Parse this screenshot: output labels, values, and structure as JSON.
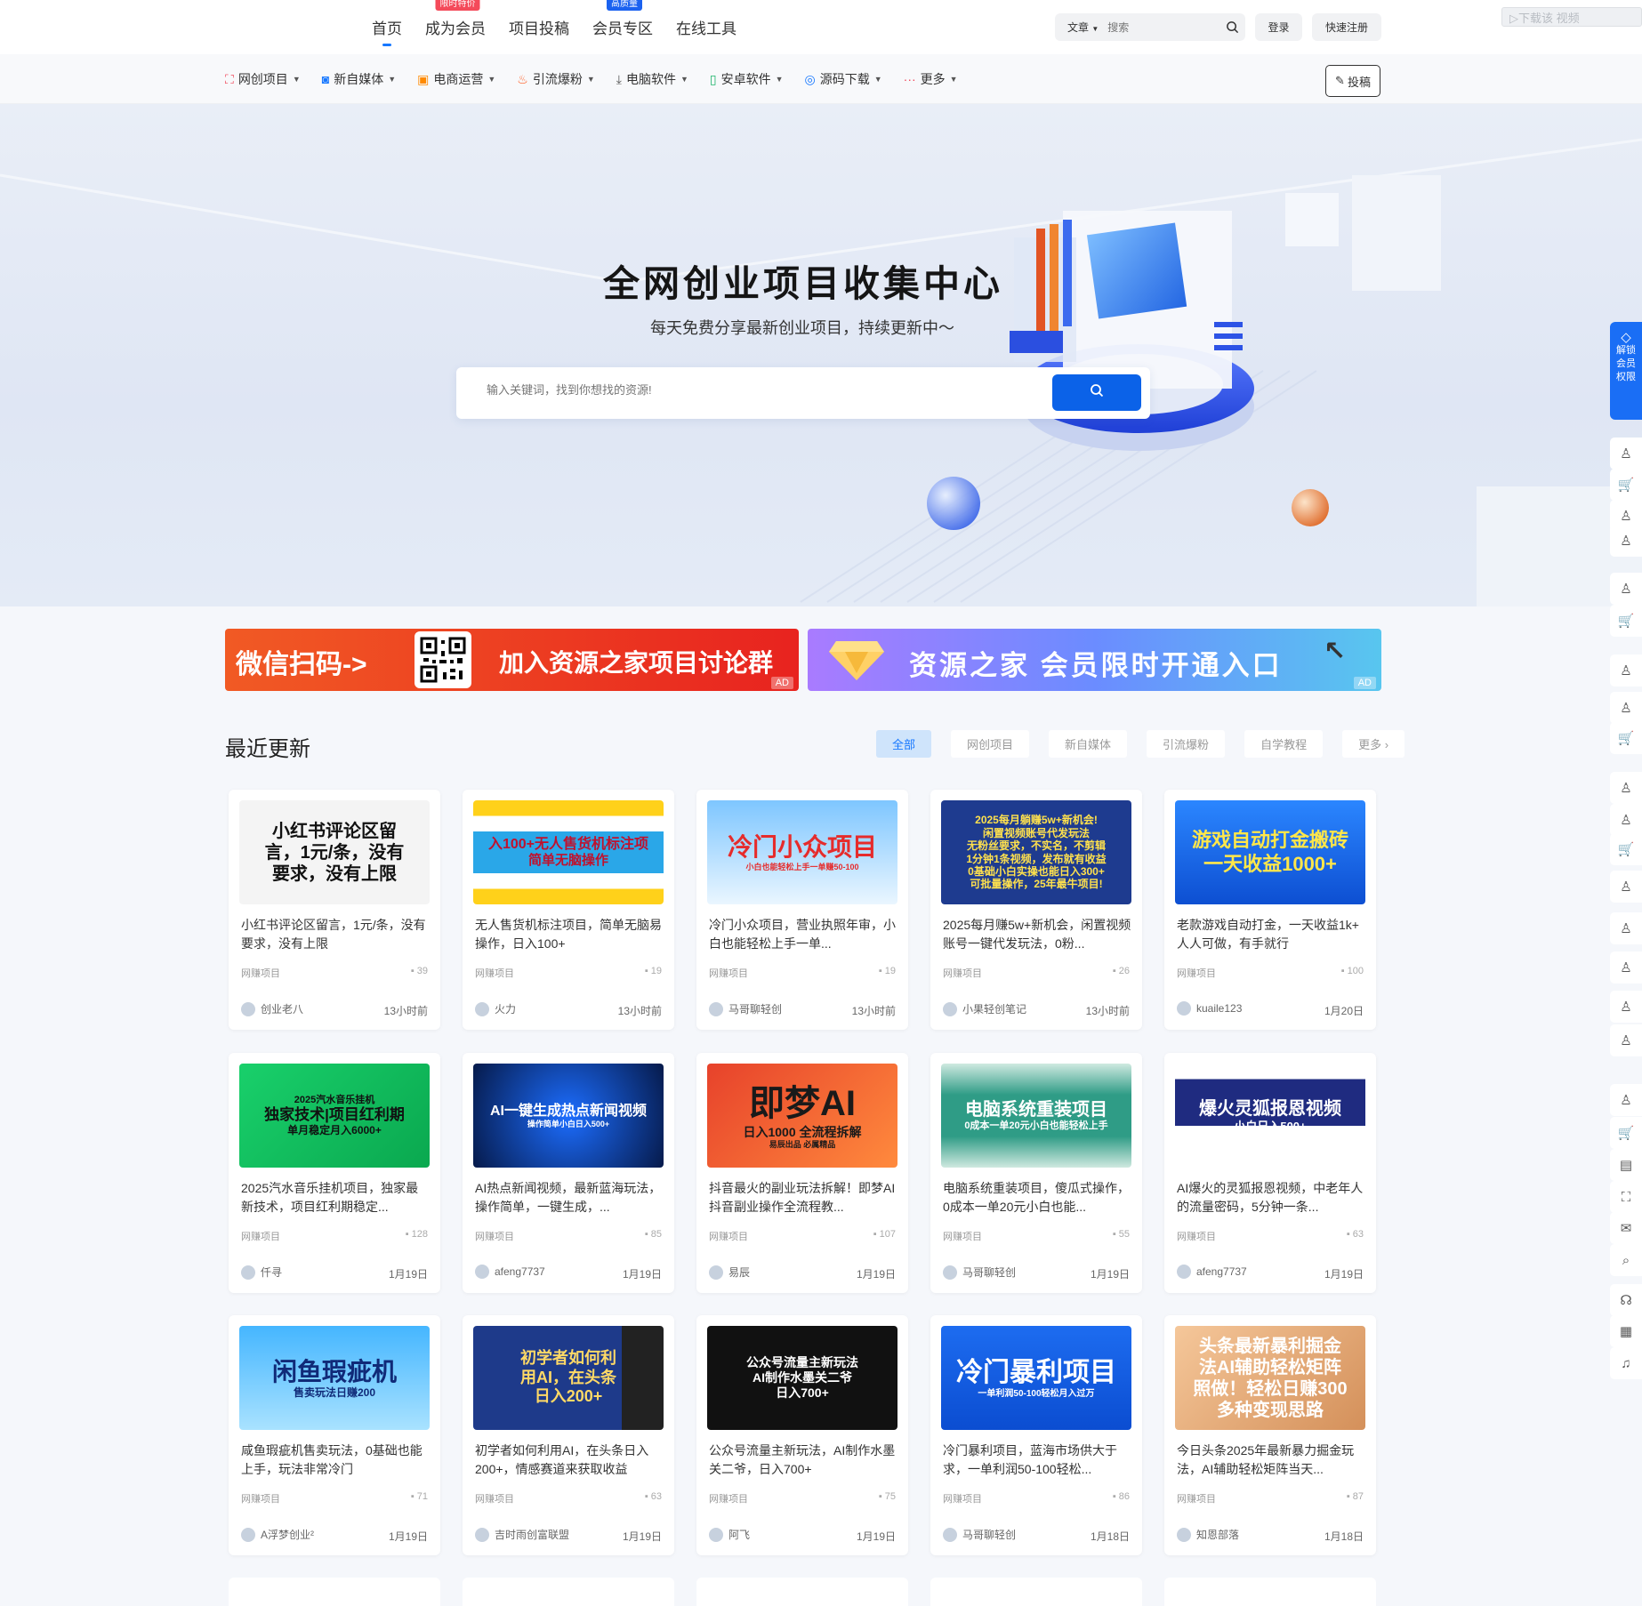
{
  "top_nav": {
    "items": [
      {
        "label": "首页",
        "badge": ""
      },
      {
        "label": "成为会员",
        "badge": "限时特价"
      },
      {
        "label": "项目投稿",
        "badge": ""
      },
      {
        "label": "会员专区",
        "badge": "高质量"
      },
      {
        "label": "在线工具",
        "badge": ""
      }
    ],
    "search_type": "文章",
    "search_placeholder": "搜索",
    "login": "登录",
    "register": "快速注册",
    "corner_ad": "▷下载该 视频"
  },
  "cat_nav": {
    "items": [
      "网创项目",
      "新自媒体",
      "电商运营",
      "引流爆粉",
      "电脑软件",
      "安卓软件",
      "源码下载",
      "更多"
    ],
    "post": "投稿"
  },
  "hero": {
    "title": "全网创业项目收集中心",
    "subtitle": "每天免费分享最新创业项目，持续更新中～",
    "search_placeholder": "输入关键词，找到你想找的资源!"
  },
  "banners": [
    {
      "left_text": "微信扫码->",
      "right_text": "加入资源之家项目讨论群",
      "ad": "AD"
    },
    {
      "text": "资源之家 会员限时开通入口",
      "ad": "AD"
    }
  ],
  "section": {
    "title": "最近更新",
    "tabs": [
      "全部",
      "网创项目",
      "新自媒体",
      "引流爆粉",
      "自学教程",
      "更多 ›"
    ]
  },
  "cards": [
    {
      "thumb_lines": [
        "小红书评论区留",
        "言，1元/条，没有",
        "要求，没有上限"
      ],
      "title": "小红书评论区留言，1元/条，没有要求，没有上限",
      "tag": "网赚项目",
      "comments": "39",
      "author": "创业老八",
      "time": "13小时前"
    },
    {
      "thumb_lines": [
        "入100+无人售货机标注项",
        "简单无脑操作"
      ],
      "title": "无人售货机标注项目，简单无脑易操作，日入100+",
      "tag": "网赚项目",
      "comments": "19",
      "author": "火力",
      "time": "13小时前"
    },
    {
      "thumb_lines": [
        "冷门小众项目",
        "小白也能轻松上手一单赚50-100"
      ],
      "title": "冷门小众项目，营业执照年审，小白也能轻松上手一单...",
      "tag": "网赚项目",
      "comments": "19",
      "author": "马哥聊轻创",
      "time": "13小时前"
    },
    {
      "thumb_lines": [
        "2025每月躺赚5w+新机会!",
        "闲置视频账号代发玩法",
        "无粉丝要求，不实名，不剪辑",
        "1分钟1条视频，发布就有收益",
        "0基础小白实操也能日入300+",
        "可批量操作，25年最牛项目!"
      ],
      "title": "2025每月赚5w+新机会，闲置视频账号一键代发玩法，0粉...",
      "tag": "网赚项目",
      "comments": "26",
      "author": "小果轻创笔记",
      "time": "13小时前"
    },
    {
      "thumb_lines": [
        "游戏自动打金搬砖",
        "一天收益1000+"
      ],
      "title": "老款游戏自动打金，一天收益1k+ 人人可做，有手就行",
      "tag": "网赚项目",
      "comments": "100",
      "author": "kuaile123",
      "time": "1月20日"
    },
    {
      "thumb_lines": [
        "2025汽水音乐挂机",
        "独家技术|项目红利期",
        "单月稳定月入6000+"
      ],
      "title": "2025汽水音乐挂机项目，独家最新技术，项目红利期稳定...",
      "tag": "网赚项目",
      "comments": "128",
      "author": "仟寻",
      "time": "1月19日"
    },
    {
      "thumb_lines": [
        "AI一键生成热点新闻视频",
        "操作简单小白日入500+"
      ],
      "title": "AI热点新闻视频，最新蓝海玩法，操作简单，一键生成，...",
      "tag": "网赚项目",
      "comments": "85",
      "author": "afeng7737",
      "time": "1月19日"
    },
    {
      "thumb_lines": [
        "即梦AI",
        "日入1000 全流程拆解",
        "易辰出品 必属精品"
      ],
      "title": "抖音最火的副业玩法拆解！即梦AI抖音副业操作全流程教...",
      "tag": "网赚项目",
      "comments": "107",
      "author": "易辰",
      "time": "1月19日"
    },
    {
      "thumb_lines": [
        "电脑系统重装项目",
        "0成本一单20元小白也能轻松上手"
      ],
      "title": "电脑系统重装项目，傻瓜式操作，0成本一单20元小白也能...",
      "tag": "网赚项目",
      "comments": "55",
      "author": "马哥聊轻创",
      "time": "1月19日"
    },
    {
      "thumb_lines": [
        "爆火灵狐报恩视频",
        "小白日入500+"
      ],
      "title": "AI爆火的灵狐报恩视频，中老年人的流量密码，5分钟一条...",
      "tag": "网赚项目",
      "comments": "63",
      "author": "afeng7737",
      "time": "1月19日"
    },
    {
      "thumb_lines": [
        "闲鱼瑕疵机",
        "售卖玩法日赚200"
      ],
      "title": "咸鱼瑕疵机售卖玩法，0基础也能上手，玩法非常冷门",
      "tag": "网赚项目",
      "comments": "71",
      "author": "A浮梦创业²",
      "time": "1月19日"
    },
    {
      "thumb_lines": [
        "初学者如何利",
        "用AI，在头条",
        "日入200+"
      ],
      "title": "初学者如何利用AI，在头条日入200+，情感赛道来获取收益",
      "tag": "网赚项目",
      "comments": "63",
      "author": "吉时雨创富联盟",
      "time": "1月19日"
    },
    {
      "thumb_lines": [
        "公众号流量主新玩法",
        "AI制作水墨关二爷",
        "日入700+"
      ],
      "title": "公众号流量主新玩法，AI制作水墨关二爷，日入700+",
      "tag": "网赚项目",
      "comments": "75",
      "author": "阿飞",
      "time": "1月19日"
    },
    {
      "thumb_lines": [
        "冷门暴利项目",
        "一单利润50-100轻松月入过万"
      ],
      "title": "冷门暴利项目，蓝海市场供大于求，一单利润50-100轻松...",
      "tag": "网赚项目",
      "comments": "86",
      "author": "马哥聊轻创",
      "time": "1月18日"
    },
    {
      "thumb_lines": [
        "头条最新暴利掘金",
        "法AI辅助轻松矩阵",
        "照做！轻松日赚300",
        "多种变现思路"
      ],
      "title": "今日头条2025年最新暴力掘金玩法，AI辅助轻松矩阵当天...",
      "tag": "网赚项目",
      "comments": "87",
      "author": "知恩部落",
      "time": "1月18日"
    }
  ],
  "right_bar": {
    "unlock": "解锁会员权限"
  },
  "colors": {
    "accent": "#1677ff",
    "brand_blue": "#0b62e8"
  }
}
